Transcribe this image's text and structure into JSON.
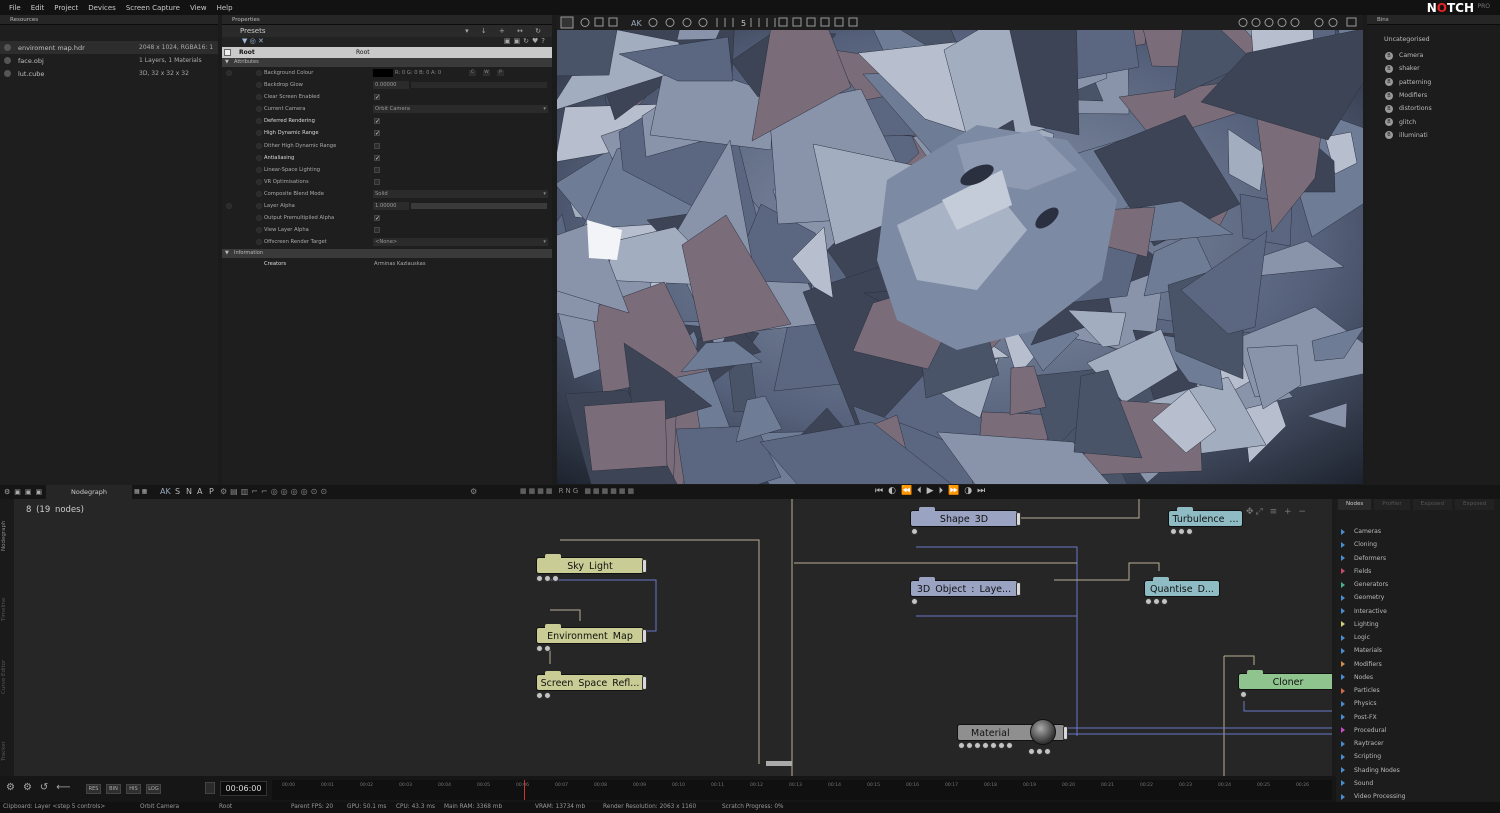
{
  "menu": [
    "File",
    "Edit",
    "Project",
    "Devices",
    "Screen Capture",
    "View",
    "Help"
  ],
  "logo": {
    "text_a": "N",
    "text_b": "O",
    "text_c": "TCH",
    "pro": "PRO"
  },
  "resources": {
    "title": "Resources",
    "rows": [
      {
        "name": "enviroment map.hdr",
        "detail": "2048 x 1024, RGBA16: 1"
      },
      {
        "name": "face.obj",
        "detail": "1 Layers, 1 Materials"
      },
      {
        "name": "lut.cube",
        "detail": "3D, 32 x 32 x 32"
      }
    ]
  },
  "properties": {
    "title": "Properties",
    "presets": "Presets",
    "root": {
      "label": "Root",
      "value": "Root"
    },
    "sect_attributes": "Attributes",
    "rows": [
      {
        "label": "Background Colour",
        "value": "R: 0 G: 0 B: 0 A: 0",
        "bold": false,
        "kind": "color"
      },
      {
        "label": "Backdrop Glow",
        "value": "0.00000",
        "bold": false,
        "kind": "field"
      },
      {
        "label": "Clear Screen Enabled",
        "value": "✓",
        "bold": false,
        "kind": "check"
      },
      {
        "label": "Current Camera",
        "value": "Orbit Camera",
        "bold": false,
        "kind": "select"
      },
      {
        "label": "Deferred Rendering",
        "value": "✓",
        "bold": true,
        "kind": "check"
      },
      {
        "label": "High Dynamic Range",
        "value": "✓",
        "bold": true,
        "kind": "check"
      },
      {
        "label": "Dither High Dynamic Range",
        "value": "",
        "bold": false,
        "kind": "check"
      },
      {
        "label": "Antialiasing",
        "value": "✓",
        "bold": true,
        "kind": "check"
      },
      {
        "label": "Linear-Space Lighting",
        "value": "",
        "bold": false,
        "kind": "check"
      },
      {
        "label": "VR Optimisations",
        "value": "",
        "bold": false,
        "kind": "check"
      },
      {
        "label": "Composite Blend Mode",
        "value": "Solid",
        "bold": false,
        "kind": "select"
      },
      {
        "label": "Layer Alpha",
        "value": "1.00000",
        "bold": false,
        "kind": "field"
      },
      {
        "label": "Output Premultiplied Alpha",
        "value": "✓",
        "bold": false,
        "kind": "check"
      },
      {
        "label": "View Layer Alpha",
        "value": "",
        "bold": false,
        "kind": "check"
      },
      {
        "label": "Offscreen Render Target",
        "value": "<None>",
        "bold": false,
        "kind": "select"
      }
    ],
    "sect_information": "Information",
    "creators": {
      "label": "Creators",
      "value": "Arminas Kazlauskas"
    },
    "color_channels": [
      "C",
      "W",
      "P"
    ]
  },
  "bins": {
    "title": "Bins",
    "heading": "Uncategorised",
    "items": [
      "Camera",
      "shaker",
      "patterning",
      "Modifiers",
      "distortions",
      "glitch",
      "illuminati"
    ]
  },
  "nodegraph": {
    "tab": "Nodegraph",
    "snap": [
      "AK",
      "S",
      "N",
      "A",
      "P"
    ],
    "count": "8  (19  nodes)",
    "nodes": [
      {
        "id": "sky",
        "label": "Sky  Light",
        "color": "#c9cc94"
      },
      {
        "id": "env",
        "label": "Environment  Map",
        "color": "#c9cc94"
      },
      {
        "id": "ssr",
        "label": "Screen  Space  Refl...",
        "color": "#c9cc94"
      },
      {
        "id": "shape",
        "label": "Shape  3D",
        "color": "#9aa3c2"
      },
      {
        "id": "obj",
        "label": "3D  Object  :  Laye...",
        "color": "#9aa3c2"
      },
      {
        "id": "turb",
        "label": "Turbulence  ...",
        "color": "#8fbcc4"
      },
      {
        "id": "quant",
        "label": "Quantise  D...",
        "color": "#8fbcc4"
      },
      {
        "id": "cloner",
        "label": "Cloner",
        "color": "#8fc48f"
      },
      {
        "id": "mat",
        "label": "Material",
        "color": "#8f8f8f"
      }
    ],
    "side_tabs": [
      "Nodegraph",
      "Timeline",
      "Curve Editor",
      "Tracker"
    ]
  },
  "nodes_panel": {
    "tabs": [
      "Nodes",
      "Profiler",
      "Exposed",
      "Exposed"
    ],
    "items": [
      {
        "label": "Cameras",
        "color": "#4a8cd0"
      },
      {
        "label": "Cloning",
        "color": "#4a8cd0"
      },
      {
        "label": "Deformers",
        "color": "#4a8cd0"
      },
      {
        "label": "Fields",
        "color": "#c84a6a"
      },
      {
        "label": "Generators",
        "color": "#4ab08c"
      },
      {
        "label": "Geometry",
        "color": "#4a8cd0"
      },
      {
        "label": "Interactive",
        "color": "#4a8cd0"
      },
      {
        "label": "Lighting",
        "color": "#d0d07a"
      },
      {
        "label": "Logic",
        "color": "#4a8cd0"
      },
      {
        "label": "Materials",
        "color": "#4a8cd0"
      },
      {
        "label": "Modifiers",
        "color": "#d08c4a"
      },
      {
        "label": "Nodes",
        "color": "#4a8cd0"
      },
      {
        "label": "Particles",
        "color": "#d06a4a"
      },
      {
        "label": "Physics",
        "color": "#4a8cd0"
      },
      {
        "label": "Post-FX",
        "color": "#4a8cd0"
      },
      {
        "label": "Procedural",
        "color": "#c84ac8"
      },
      {
        "label": "Raytracer",
        "color": "#4a8cd0"
      },
      {
        "label": "Scripting",
        "color": "#4a8cd0"
      },
      {
        "label": "Shading Nodes",
        "color": "#4a8cd0"
      },
      {
        "label": "Sound",
        "color": "#4a8cd0"
      },
      {
        "label": "Video Processing",
        "color": "#4a8cd0"
      }
    ]
  },
  "timeline": {
    "timecode": "00:06:00",
    "buttons": [
      "RES",
      "BIN",
      "HIS",
      "LOG"
    ],
    "ticks": [
      "00:00",
      "00:01",
      "00:02",
      "00:03",
      "00:04",
      "00:05",
      "00:06",
      "00:07",
      "00:08",
      "00:09",
      "00:10",
      "00:11",
      "00:12",
      "00:13",
      "00:14",
      "00:15",
      "00:16",
      "00:17",
      "00:18",
      "00:19",
      "00:20",
      "00:21",
      "00:22",
      "00:23",
      "00:24",
      "00:25",
      "00:26"
    ]
  },
  "status": {
    "clipboard": "Clipboard: Layer <step 5 controls>",
    "camera": "Orbit Camera",
    "root": "Root",
    "fps": "Parent FPS: 20",
    "gpu": "GPU: 50.1 ms",
    "cpu": "CPU: 43.3 ms",
    "ram": "Main RAM: 3368 mb",
    "vram": "VRAM: 13734 mb",
    "res": "Render Resolution: 2063 x 1160",
    "scratch": "Scratch Progress: 0%"
  },
  "viewport_toolbar": {
    "frame": "5"
  }
}
